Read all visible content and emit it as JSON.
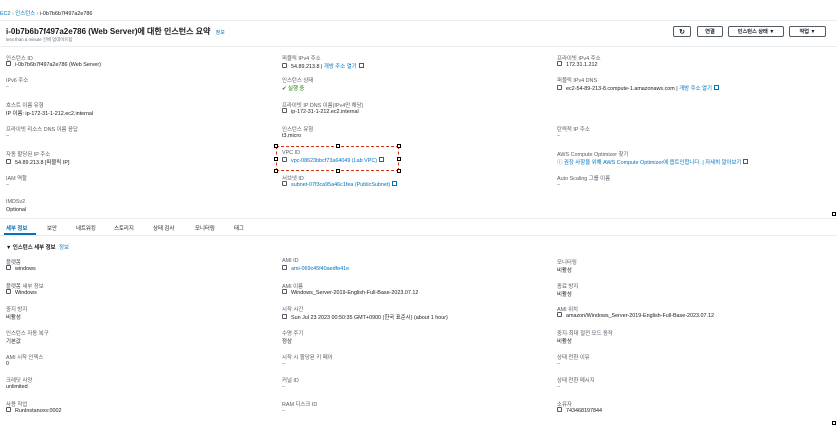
{
  "breadcrumb": {
    "ec2": "EC2",
    "instances": "인스턴스",
    "current": "i-0b7b6b7f497a2e786"
  },
  "header": {
    "title": "i-0b7b6b7f497a2e786 (Web Server)에 대한 인스턴스 요약",
    "info": "정보",
    "subtitle": "less than a minute 전에 업데이트됨",
    "refresh_icon": "refresh-icon",
    "connect": "연결",
    "instance_state": "인스턴스 상태 ▼",
    "actions": "작업 ▼"
  },
  "summary": {
    "instance_id_label": "인스턴스 ID",
    "instance_id": "i-0b7b6b7f497a2e786 (Web Server)",
    "ipv6_label": "IPv6 주소",
    "ipv6": "–",
    "hostname_type_label": "호스트 이름 유형",
    "hostname_type": "IP 이름: ip-172-31-1-212.ec2.internal",
    "private_dns_resolve_label": "프라이빗 리소스 DNS 이름 응답",
    "private_dns_resolve": "–",
    "auto_ip_label": "자동 할당된 IP 주소",
    "auto_ip": "54.89.213.8 [퍼블릭 IP]",
    "iam_label": "IAM 역할",
    "iam": "–",
    "imds_label": "IMDSv2",
    "imds": "Optional",
    "public_ip_label": "퍼블릭 IPv4 주소",
    "public_ip": "54.89.213.8",
    "public_ip_link": "개방 주소 열기",
    "state_label": "인스턴스 상태",
    "state": "실행 중",
    "private_dns_label": "프라이빗 IP DNS 이름(IPv4만 해당)",
    "private_dns": "ip-172-31-1-212.ec2.internal",
    "type_label": "인스턴스 유형",
    "type": "t3.micro",
    "vpc_label": "VPC ID",
    "vpc": "vpc-08623bbcf73a64049 (Lab VPC)",
    "subnet_label": "서브넷 ID",
    "subnet": "subnet-07f3ca95a46c1fea (PublicSubnet)",
    "private_ip_label": "프라이빗 IPv4 주소",
    "private_ip": "172.31.1.212",
    "public_dns_label": "퍼블릭 IPv4 DNS",
    "public_dns": "ec2-54-89-213-8.compute-1.amazonaws.com",
    "public_dns_link": "개방 주소 열기",
    "elastic_ip_label": "탄력적 IP 주소",
    "elastic_ip": "–",
    "optimizer_label": "AWS Compute Optimizer 찾기",
    "optimizer": "권장 사항을 위해 AWS Compute Optimizer에 옵트인합니다. | 자세히 알아보기",
    "asg_label": "Auto Scaling 그룹 이름",
    "asg": "–"
  },
  "tabs": [
    "세부 정보",
    "보안",
    "네트워킹",
    "스토리지",
    "상태 검사",
    "모니터링",
    "태그"
  ],
  "details": {
    "section_title": "▼ 인스턴스 세부 정보",
    "section_info": "정보",
    "platform_label": "플랫폼",
    "platform": "windows",
    "platform_detail_label": "플랫폼 세부 정보",
    "platform_detail": "Windows",
    "stop_protect_label": "중지 방지",
    "stop_protect": "비활성",
    "recovery_label": "인스턴스 자동 복구",
    "recovery": "기본값",
    "ami_launch_label": "AMI 시작 인덱스",
    "ami_launch": "0",
    "credit_label": "크레딧 사양",
    "credit": "unlimited",
    "usage_label": "사용 작업",
    "usage": "RunInstances:0002",
    "ami_id_label": "AMI ID",
    "ami_id": "ami-069c45f40aedfe41e",
    "ami_name_label": "AMI 이름",
    "ami_name": "Windows_Server-2019-English-Full-Base-2023.07.12",
    "launch_time_label": "시작 시간",
    "launch_time": "Sun Jul 23 2023 00:50:35 GMT+0900 (한국 표준시) (about 1 hour)",
    "lifecycle_label": "수명 주기",
    "lifecycle": "정상",
    "stop_hibernate_label": "시작 시 할당된 키 페어",
    "stop_hibernate": "–",
    "kernel_label": "커널 ID",
    "kernel": "–",
    "ram_label": "RAM 디스크 ID",
    "ram": "–",
    "monitoring_label": "모니터링",
    "monitoring": "비활성",
    "term_protect_label": "종료 방지",
    "term_protect": "비활성",
    "ami_loc_label": "AMI 위치",
    "ami_loc": "amazon/Windows_Server-2019-English-Full-Base-2023.07.12",
    "hibernate_label": "중지-최대 절전 모드 동작",
    "hibernate": "비활성",
    "state_reason_label": "상태 전환 이유",
    "state_reason": "–",
    "state_msg_label": "상태 전환 메시지",
    "state_msg": "–",
    "owner_label": "소유자",
    "owner": "743468197844"
  }
}
